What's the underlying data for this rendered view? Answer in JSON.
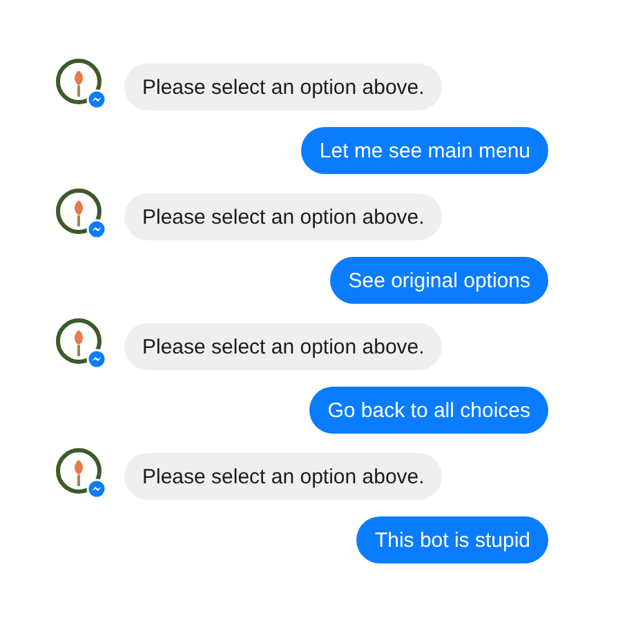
{
  "messages": [
    {
      "kind": "incoming",
      "text": "Please select an option above."
    },
    {
      "kind": "outgoing",
      "text": "Let me see main menu"
    },
    {
      "kind": "incoming",
      "text": "Please select an option above."
    },
    {
      "kind": "outgoing",
      "text": "See original options"
    },
    {
      "kind": "incoming",
      "text": "Please select an option above."
    },
    {
      "kind": "outgoing",
      "text": "Go back to all choices"
    },
    {
      "kind": "incoming",
      "text": "Please select an option above."
    },
    {
      "kind": "outgoing",
      "text": "This bot is stupid"
    }
  ]
}
